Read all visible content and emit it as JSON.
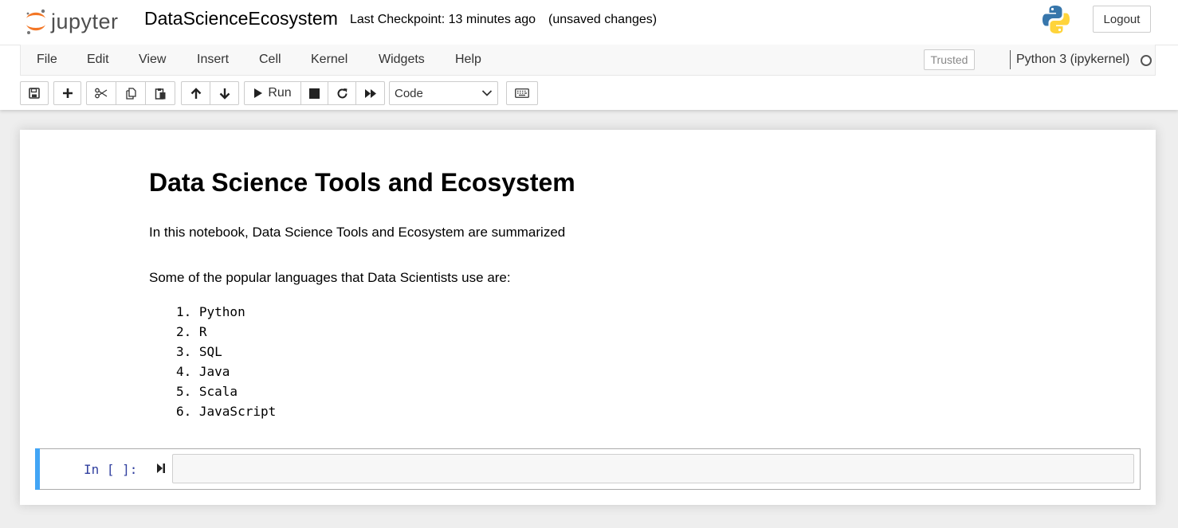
{
  "header": {
    "logo_text": "jupyter",
    "notebook_name": "DataScienceEcosystem",
    "checkpoint": "Last Checkpoint: 13 minutes ago",
    "save_status": "(unsaved changes)",
    "logout_label": "Logout"
  },
  "menu": {
    "items": [
      "File",
      "Edit",
      "View",
      "Insert",
      "Cell",
      "Kernel",
      "Widgets",
      "Help"
    ],
    "trusted_label": "Trusted",
    "kernel_name": "Python 3 (ipykernel)"
  },
  "toolbar": {
    "run_label": "Run",
    "cell_type": "Code",
    "buttons": [
      "save-icon",
      "plus-icon",
      "cut-icon",
      "copy-icon",
      "paste-icon",
      "arrow-up-icon",
      "arrow-down-icon",
      "play-icon",
      "stop-icon",
      "restart-icon",
      "fast-forward-icon",
      "keyboard-icon"
    ]
  },
  "notebook": {
    "title": "Data Science Tools and Ecosystem",
    "intro": "In this notebook, Data Science Tools and Ecosystem are summarized",
    "languages_heading": "Some of the popular languages that Data Scientists use are:",
    "languages": [
      "1. Python",
      "2. R",
      "3. SQL",
      "4. Java",
      "5. Scala",
      "6. JavaScript"
    ],
    "code_prompt": "In [ ]:"
  },
  "colors": {
    "jupyter_orange": "#f37726",
    "selected_cell_bar": "#42a5f5",
    "prompt_blue": "#303f9f"
  }
}
